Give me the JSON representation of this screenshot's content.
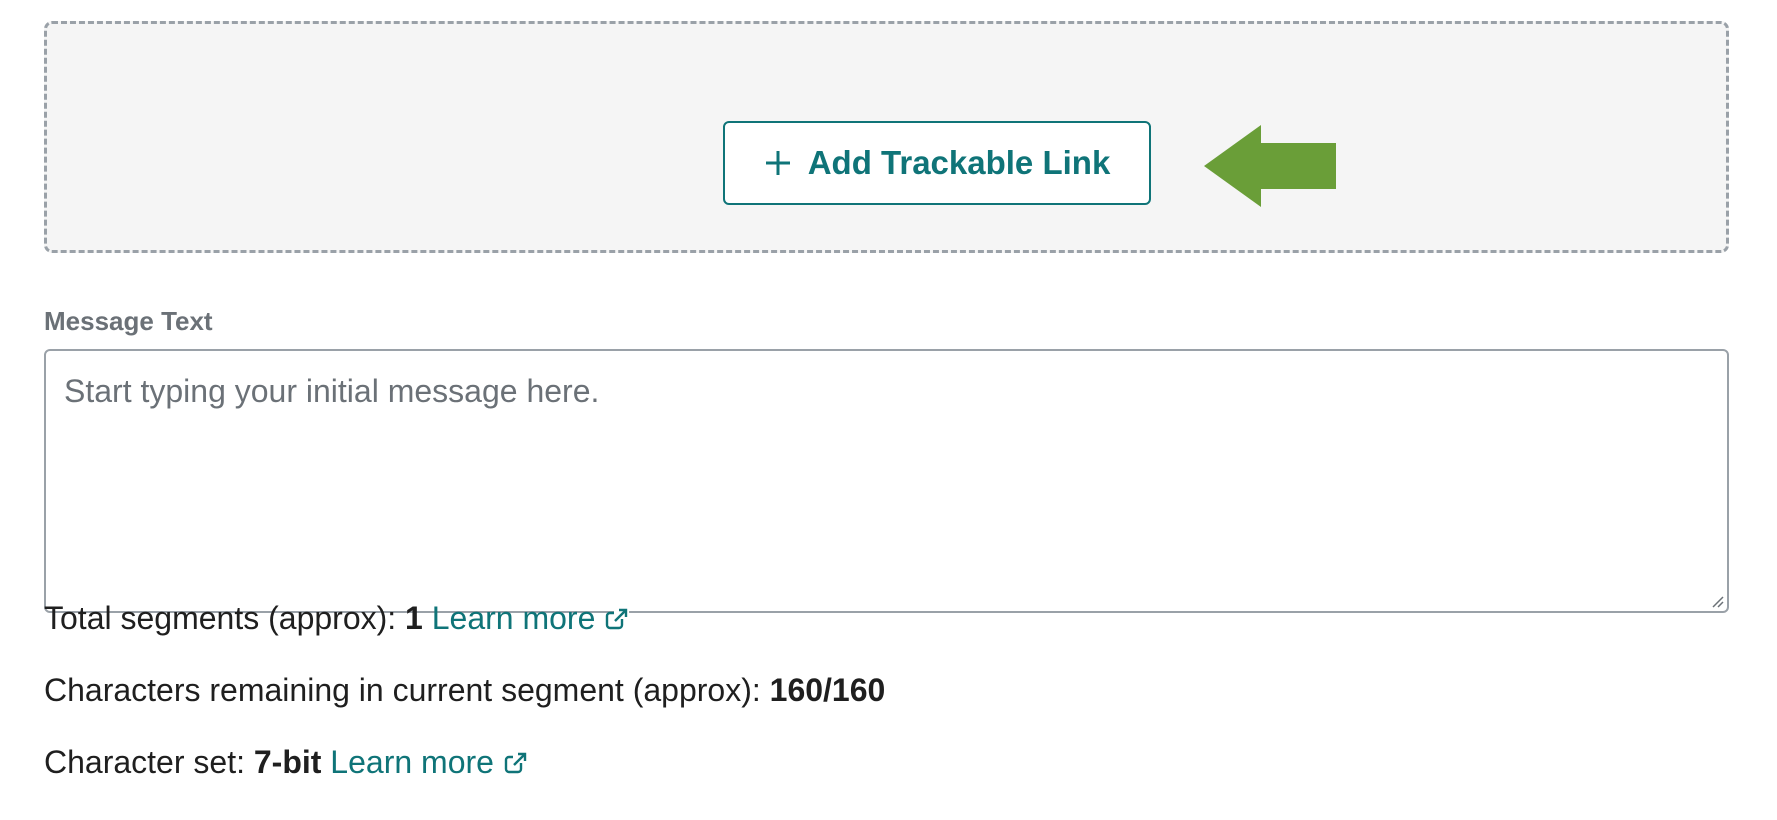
{
  "link_section": {
    "add_button_label": "Add Trackable Link",
    "add_button_icon": "plus-icon",
    "annotation_arrow_color": "#6a9e38"
  },
  "message": {
    "label": "Message Text",
    "placeholder": "Start typing your initial message here.",
    "value": ""
  },
  "stats": {
    "segments_label": "Total segments (approx):",
    "segments_value": "1",
    "segments_link": "Learn more",
    "remaining_label": "Characters remaining in current segment (approx):",
    "remaining_value": "160/160",
    "charset_label": "Character set:",
    "charset_value": "7-bit",
    "charset_link": "Learn more",
    "link_icon": "external-link-icon"
  },
  "colors": {
    "accent": "#0f7478",
    "muted_text": "#6b7177",
    "border": "#9aa1a8",
    "zone_bg": "#f5f5f5"
  }
}
